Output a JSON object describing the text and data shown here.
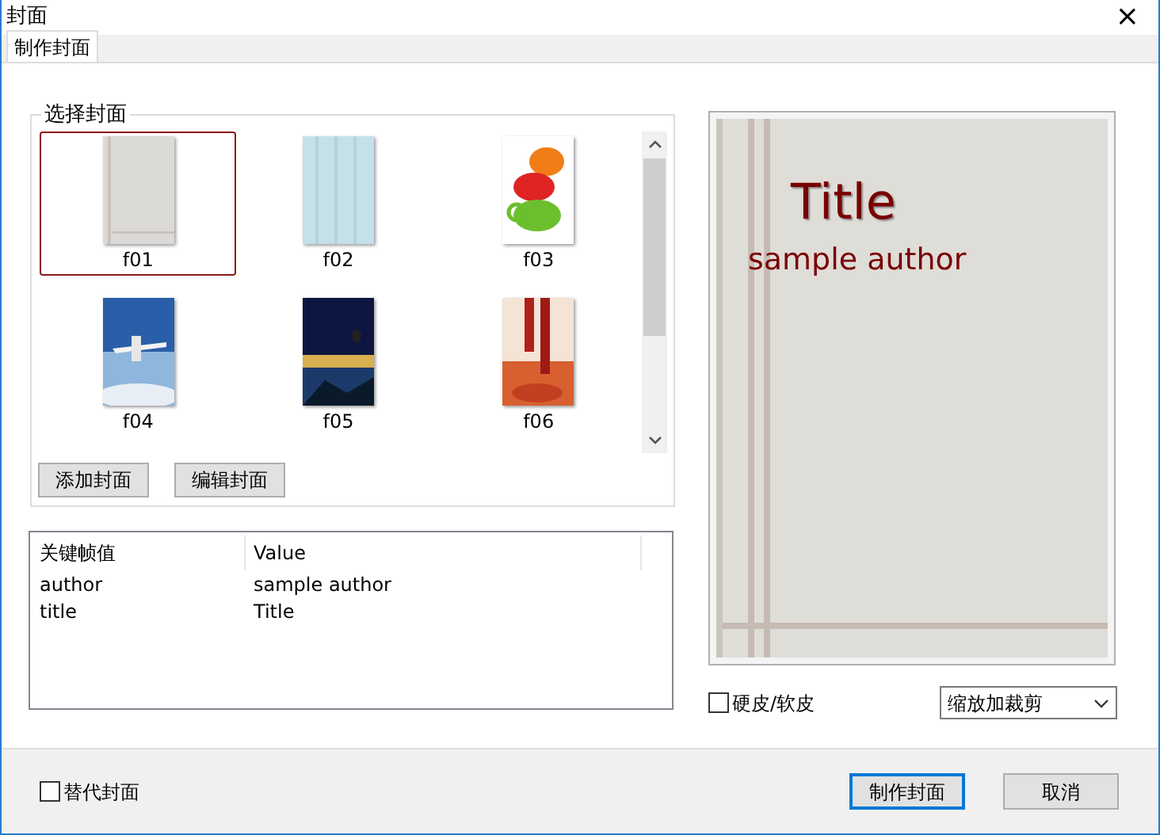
{
  "window": {
    "title": "封面",
    "close": "×"
  },
  "tabs": [
    {
      "label": "制作封面",
      "selected": true
    }
  ],
  "cover_group": {
    "title": "选择封面",
    "covers": [
      {
        "label": "f01",
        "selected": true
      },
      {
        "label": "f02",
        "selected": false
      },
      {
        "label": "f03",
        "selected": false
      },
      {
        "label": "f04",
        "selected": false
      },
      {
        "label": "f05",
        "selected": false
      },
      {
        "label": "f06",
        "selected": false
      }
    ],
    "buttons": [
      "添加封面",
      "编辑封面"
    ]
  },
  "table": {
    "columns": [
      "关键帧值",
      "Value"
    ],
    "rows": [
      [
        "author",
        "sample author"
      ],
      [
        "title",
        "Title"
      ]
    ]
  },
  "preview": {
    "title": "Title",
    "author": "sample author"
  },
  "hardcover": {
    "label": "硬皮/软皮",
    "checked": false
  },
  "scale_mode": {
    "value": "缩放加裁剪"
  },
  "replace_cover": {
    "label": "替代封面",
    "checked": false
  },
  "buttons": [
    {
      "label": "制作封面",
      "kind": "default"
    },
    {
      "label": "取消",
      "kind": "normal"
    }
  ]
}
